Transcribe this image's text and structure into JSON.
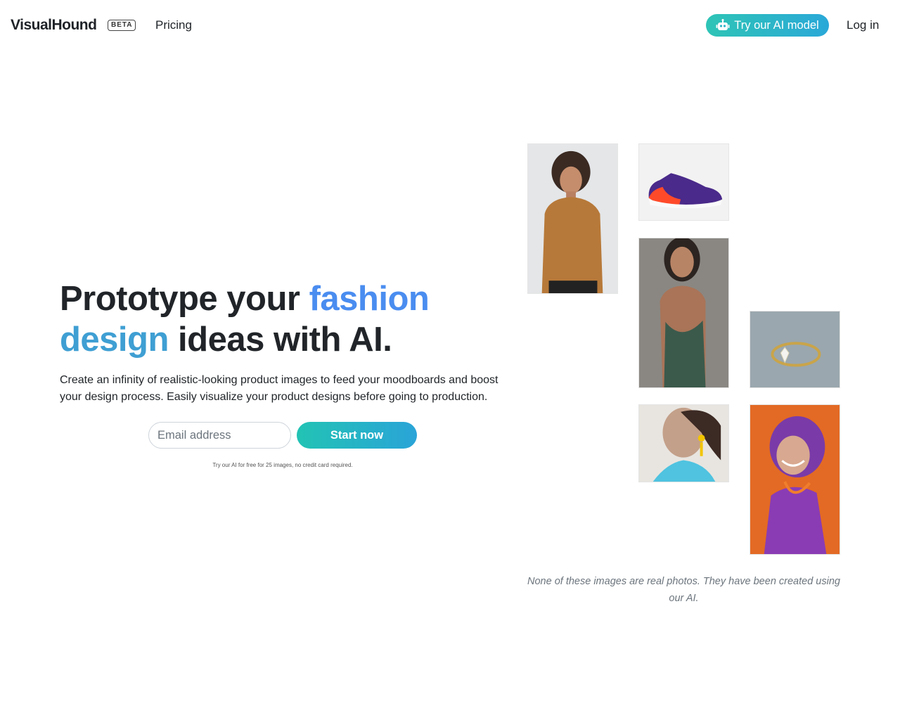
{
  "header": {
    "logo": "VisualHound",
    "badge": "BETA",
    "nav_pricing": "Pricing",
    "try_ai_button": "Try our AI model",
    "login": "Log in"
  },
  "hero": {
    "title_part1": "Prototype your ",
    "title_accent1": "fashion",
    "title_accent2": "design",
    "title_part2": " ideas with AI.",
    "subtitle": "Create an infinity of realistic-looking product images to feed your moodboards and boost your design process. Easily visualize your product designs before going to production.",
    "email_placeholder": "Email address",
    "cta": "Start now",
    "fine_print": "Try our AI for free for 25 images, no credit card required."
  },
  "gallery": {
    "images": [
      "man in brown t-shirt",
      "purple and orange sneaker",
      "woman in green dress",
      "gold diamond ring",
      "woman with yellow earrings",
      "smiling woman with purple hair"
    ],
    "caption": "None of these images are real photos. They have been created using our AI."
  },
  "colors": {
    "accent_blue": "#4a8df0",
    "accent_teal": "#22c3b4"
  }
}
